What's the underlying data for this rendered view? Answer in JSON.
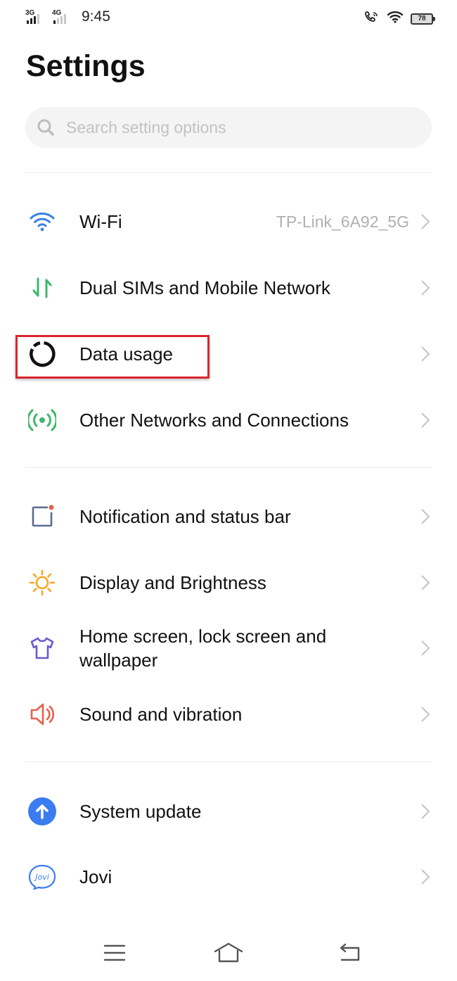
{
  "status_bar": {
    "net1": "3G",
    "net2": "4G",
    "time": "9:45",
    "battery": "78"
  },
  "page": {
    "title": "Settings"
  },
  "search": {
    "placeholder": "Search setting options"
  },
  "sections": [
    {
      "items": [
        {
          "label": "Wi-Fi",
          "value": "TP-Link_6A92_5G",
          "icon": "wifi-icon",
          "color": "#3b82e0"
        },
        {
          "label": "Dual SIMs and Mobile Network",
          "icon": "mobile-network-icon",
          "color": "#3fb56f"
        },
        {
          "label": "Data usage",
          "icon": "data-usage-icon",
          "color": "#111111"
        },
        {
          "label": "Other Networks and Connections",
          "icon": "connections-icon",
          "color": "#3fb56f"
        }
      ]
    },
    {
      "items": [
        {
          "label": "Notification and status bar",
          "icon": "notification-icon",
          "color": "#5b6c8f"
        },
        {
          "label": "Display and Brightness",
          "icon": "sun-icon",
          "color": "#f5a623"
        },
        {
          "label": "Home screen, lock screen and wallpaper",
          "icon": "tshirt-icon",
          "color": "#6a5acd"
        },
        {
          "label": "Sound and vibration",
          "icon": "speaker-icon",
          "color": "#e8604c"
        }
      ]
    },
    {
      "items": [
        {
          "label": "System update",
          "icon": "system-update-icon",
          "color": "#3b7cf0"
        },
        {
          "label": "Jovi",
          "icon": "jovi-icon",
          "color": "#3b7cf0",
          "icon_text": "Jovi"
        }
      ]
    }
  ],
  "highlight_color": "#d8262e",
  "nav_bar": {
    "buttons": [
      "menu-icon",
      "home-icon",
      "back-icon"
    ]
  }
}
